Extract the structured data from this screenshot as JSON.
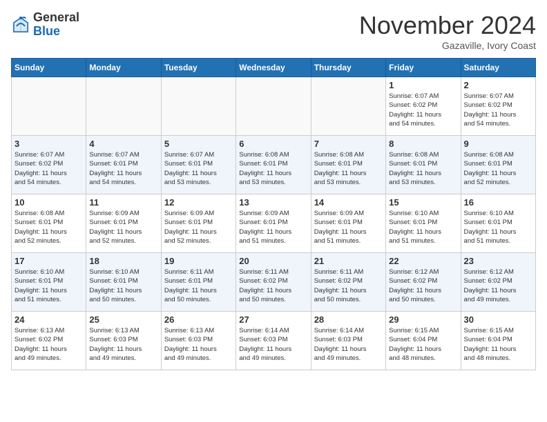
{
  "header": {
    "logo_general": "General",
    "logo_blue": "Blue",
    "month_title": "November 2024",
    "location": "Gazaville, Ivory Coast"
  },
  "days_of_week": [
    "Sunday",
    "Monday",
    "Tuesday",
    "Wednesday",
    "Thursday",
    "Friday",
    "Saturday"
  ],
  "weeks": [
    [
      {
        "day": "",
        "info": ""
      },
      {
        "day": "",
        "info": ""
      },
      {
        "day": "",
        "info": ""
      },
      {
        "day": "",
        "info": ""
      },
      {
        "day": "",
        "info": ""
      },
      {
        "day": "1",
        "info": "Sunrise: 6:07 AM\nSunset: 6:02 PM\nDaylight: 11 hours\nand 54 minutes."
      },
      {
        "day": "2",
        "info": "Sunrise: 6:07 AM\nSunset: 6:02 PM\nDaylight: 11 hours\nand 54 minutes."
      }
    ],
    [
      {
        "day": "3",
        "info": "Sunrise: 6:07 AM\nSunset: 6:02 PM\nDaylight: 11 hours\nand 54 minutes."
      },
      {
        "day": "4",
        "info": "Sunrise: 6:07 AM\nSunset: 6:01 PM\nDaylight: 11 hours\nand 54 minutes."
      },
      {
        "day": "5",
        "info": "Sunrise: 6:07 AM\nSunset: 6:01 PM\nDaylight: 11 hours\nand 53 minutes."
      },
      {
        "day": "6",
        "info": "Sunrise: 6:08 AM\nSunset: 6:01 PM\nDaylight: 11 hours\nand 53 minutes."
      },
      {
        "day": "7",
        "info": "Sunrise: 6:08 AM\nSunset: 6:01 PM\nDaylight: 11 hours\nand 53 minutes."
      },
      {
        "day": "8",
        "info": "Sunrise: 6:08 AM\nSunset: 6:01 PM\nDaylight: 11 hours\nand 53 minutes."
      },
      {
        "day": "9",
        "info": "Sunrise: 6:08 AM\nSunset: 6:01 PM\nDaylight: 11 hours\nand 52 minutes."
      }
    ],
    [
      {
        "day": "10",
        "info": "Sunrise: 6:08 AM\nSunset: 6:01 PM\nDaylight: 11 hours\nand 52 minutes."
      },
      {
        "day": "11",
        "info": "Sunrise: 6:09 AM\nSunset: 6:01 PM\nDaylight: 11 hours\nand 52 minutes."
      },
      {
        "day": "12",
        "info": "Sunrise: 6:09 AM\nSunset: 6:01 PM\nDaylight: 11 hours\nand 52 minutes."
      },
      {
        "day": "13",
        "info": "Sunrise: 6:09 AM\nSunset: 6:01 PM\nDaylight: 11 hours\nand 51 minutes."
      },
      {
        "day": "14",
        "info": "Sunrise: 6:09 AM\nSunset: 6:01 PM\nDaylight: 11 hours\nand 51 minutes."
      },
      {
        "day": "15",
        "info": "Sunrise: 6:10 AM\nSunset: 6:01 PM\nDaylight: 11 hours\nand 51 minutes."
      },
      {
        "day": "16",
        "info": "Sunrise: 6:10 AM\nSunset: 6:01 PM\nDaylight: 11 hours\nand 51 minutes."
      }
    ],
    [
      {
        "day": "17",
        "info": "Sunrise: 6:10 AM\nSunset: 6:01 PM\nDaylight: 11 hours\nand 51 minutes."
      },
      {
        "day": "18",
        "info": "Sunrise: 6:10 AM\nSunset: 6:01 PM\nDaylight: 11 hours\nand 50 minutes."
      },
      {
        "day": "19",
        "info": "Sunrise: 6:11 AM\nSunset: 6:01 PM\nDaylight: 11 hours\nand 50 minutes."
      },
      {
        "day": "20",
        "info": "Sunrise: 6:11 AM\nSunset: 6:02 PM\nDaylight: 11 hours\nand 50 minutes."
      },
      {
        "day": "21",
        "info": "Sunrise: 6:11 AM\nSunset: 6:02 PM\nDaylight: 11 hours\nand 50 minutes."
      },
      {
        "day": "22",
        "info": "Sunrise: 6:12 AM\nSunset: 6:02 PM\nDaylight: 11 hours\nand 50 minutes."
      },
      {
        "day": "23",
        "info": "Sunrise: 6:12 AM\nSunset: 6:02 PM\nDaylight: 11 hours\nand 49 minutes."
      }
    ],
    [
      {
        "day": "24",
        "info": "Sunrise: 6:13 AM\nSunset: 6:02 PM\nDaylight: 11 hours\nand 49 minutes."
      },
      {
        "day": "25",
        "info": "Sunrise: 6:13 AM\nSunset: 6:03 PM\nDaylight: 11 hours\nand 49 minutes."
      },
      {
        "day": "26",
        "info": "Sunrise: 6:13 AM\nSunset: 6:03 PM\nDaylight: 11 hours\nand 49 minutes."
      },
      {
        "day": "27",
        "info": "Sunrise: 6:14 AM\nSunset: 6:03 PM\nDaylight: 11 hours\nand 49 minutes."
      },
      {
        "day": "28",
        "info": "Sunrise: 6:14 AM\nSunset: 6:03 PM\nDaylight: 11 hours\nand 49 minutes."
      },
      {
        "day": "29",
        "info": "Sunrise: 6:15 AM\nSunset: 6:04 PM\nDaylight: 11 hours\nand 48 minutes."
      },
      {
        "day": "30",
        "info": "Sunrise: 6:15 AM\nSunset: 6:04 PM\nDaylight: 11 hours\nand 48 minutes."
      }
    ]
  ]
}
